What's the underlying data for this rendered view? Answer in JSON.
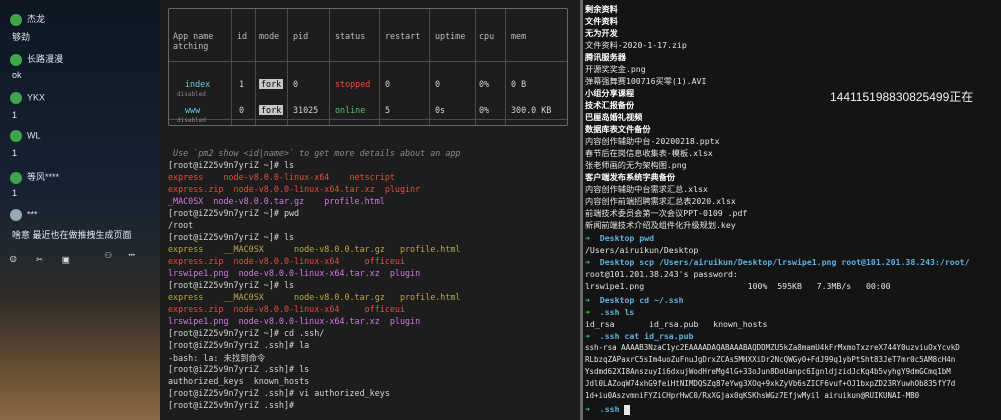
{
  "chat": {
    "messages": [
      {
        "name": "杰龙",
        "text": "够劲"
      },
      {
        "name": "长路漫漫",
        "text": "ok"
      },
      {
        "name": "YKX",
        "text": "1"
      },
      {
        "name": "WL",
        "text": "1"
      },
      {
        "name": "等风****",
        "text": "1"
      },
      {
        "name": "***",
        "text": "啥意 最近也在做推拽生成页面"
      }
    ],
    "toolbar_icons": [
      "smile-icon",
      "scissors-icon",
      "cart-icon",
      "people-icon",
      "dots-icon"
    ]
  },
  "pm2": {
    "headers": [
      "App name",
      "id",
      "mode",
      "pid",
      "status",
      "restart",
      "uptime",
      "cpu",
      "mem"
    ],
    "header_wrap": "atching",
    "rows": [
      {
        "name": "index",
        "id": "1",
        "mode": "fork",
        "pid": "0",
        "status": "stopped",
        "restart": "0",
        "uptime": "0",
        "cpu": "0%",
        "mem": "0 B",
        "sub": "disabled"
      },
      {
        "name": "www",
        "id": "0",
        "mode": "fork",
        "pid": "31025",
        "status": "online",
        "restart": "5",
        "uptime": "0s",
        "cpu": "0%",
        "mem": "300.0 KB",
        "sub": "disabled"
      }
    ],
    "hint": " Use `pm2 show <id|name>` to get more details about an app"
  },
  "termA": {
    "lines": [
      "[root@iZ25v9n7yriZ ~]# ls",
      "express    node-v8.0.0-linux-x64    netscript",
      "express.zip  node-v8.0.0-linux-x64.tar.xz  pluginr",
      "_MAC0SX  node-v8.0.0.tar.gz    profile.html",
      "[root@iZ25v9n7yriZ ~]# pwd",
      "/root",
      "[root@iZ25v9n7yriZ ~]# ls",
      "express    __MAC0SX      node-v8.0.0.tar.gz   profile.html",
      "express.zip  node-v8.0.0-linux-x64     officeui",
      "lrswipe1.png  node-v8.0.0-linux-x64.tar.xz  plugin",
      "[root@iZ25v9n7yriZ ~]# ls",
      "express    __MAC0SX      node-v8.0.0.tar.gz   profile.html",
      "express.zip  node-v8.0.0-linux-x64     officeui",
      "lrswipe1.png  node-v8.0.0-linux-x64.tar.xz  plugin",
      "[root@iZ25v9n7yriZ ~]# cd .ssh/",
      "[root@iZ25v9n7yriZ .ssh]# la",
      "-bash: la: 未找到命令",
      "[root@iZ25v9n7yriZ .ssh]# ls",
      "authorized_keys  known_hosts",
      "[root@iZ25v9n7yriZ .ssh]# vi authorized_keys",
      "[root@iZ25v9n7yriZ .ssh]# "
    ]
  },
  "termB": {
    "lines": [
      "剩余资料",
      "文件资料",
      "无为开发",
      "文件资料-2020-1-17.zip",
      "腾讯服务器",
      "开源奖奖金.png",
      "弹幕强舞赛100716买零(1).AVI",
      "小组分享课程",
      "技术汇报备份",
      "巴厘岛婚礼视频",
      "数据库表文件备份",
      "内容创作辅助中台-20200218.pptx",
      "春节后在岗信息收集表-模板.xlsx",
      "张老师画的无为架构图.png",
      "客户端发布系统字典备份",
      "内容创作辅助中台需求汇总.xlsx",
      "内容创作前端招聘需求汇总表2020.xlsx",
      "前端技术委员会第一次会议PPT-0109 .pdf",
      "新闻前端技术介绍及组件化升级规划.key",
      "Desktop pwd",
      "/Users/airuikun/Desktop",
      "Desktop scp /Users/airuikun/Desktop/lrswipe1.png root@101.201.38.243:/root/",
      "root@101.201.38.243's password:",
      "lrswipe1.png                     100%  595KB   7.3MB/s   00:00",
      "Desktop cd ~/.ssh",
      ".ssh ls",
      "id_rsa       id_rsa.pub   known_hosts",
      ".ssh cat id_rsa.pub",
      "ssh-rsa AAAAB3NzaC1yc2EAAAADAQABAAABAQDDMZU5kZa8mamU4kFrMxmoTxzreX744Y0uzviuOxYcvkD",
      "RLbzqZAPaxrC5sIm4uoZuFnuJgDrxZCAs5MHXXiDr2NcQWGy0+FdJ99q1ybPtSht83JeT7mr0c5AM8cH4n",
      "Ysdmd62XI8AnszuyIi6dxujWodHreMg4lG+33oJun8DoUanpc6IgnldjzidJcKq4b5vyhgY9dmGCmq1bM",
      "Jdl0LAZoqW74xhG9feiHtNIMDQSZq87eYwg3XOq+9xkZyVb6sZICF6vuf+OJ1bxpZD23RYuwhOb835fY7d",
      "1d+iu0AszvmniFYZiCHprHwC0/RxXGjax0qKSKhsWGz7EfjwMyil airuikun@RUIKUNAI-MB0",
      ".ssh "
    ]
  },
  "overlay_text": "1441151988308254​99正在"
}
